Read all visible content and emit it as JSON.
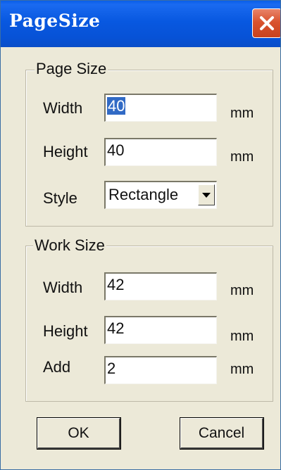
{
  "window": {
    "title": "PageSize",
    "close_icon": "close-icon"
  },
  "page_size": {
    "legend": "Page Size",
    "width_label": "Width",
    "width_value": "40",
    "height_label": "Height",
    "height_value": "40",
    "style_label": "Style",
    "style_value": "Rectangle",
    "unit": "mm"
  },
  "work_size": {
    "legend": "Work Size",
    "width_label": "Width",
    "width_value": "42",
    "height_label": "Height",
    "height_value": "42",
    "add_label": "Add",
    "add_value": "2",
    "unit": "mm"
  },
  "buttons": {
    "ok_label": "OK",
    "cancel_label": "Cancel"
  },
  "colors": {
    "titlebar": "#0858e0",
    "close_button": "#d9532f",
    "dialog_background": "#ece9d8",
    "selection": "#316ac5"
  }
}
